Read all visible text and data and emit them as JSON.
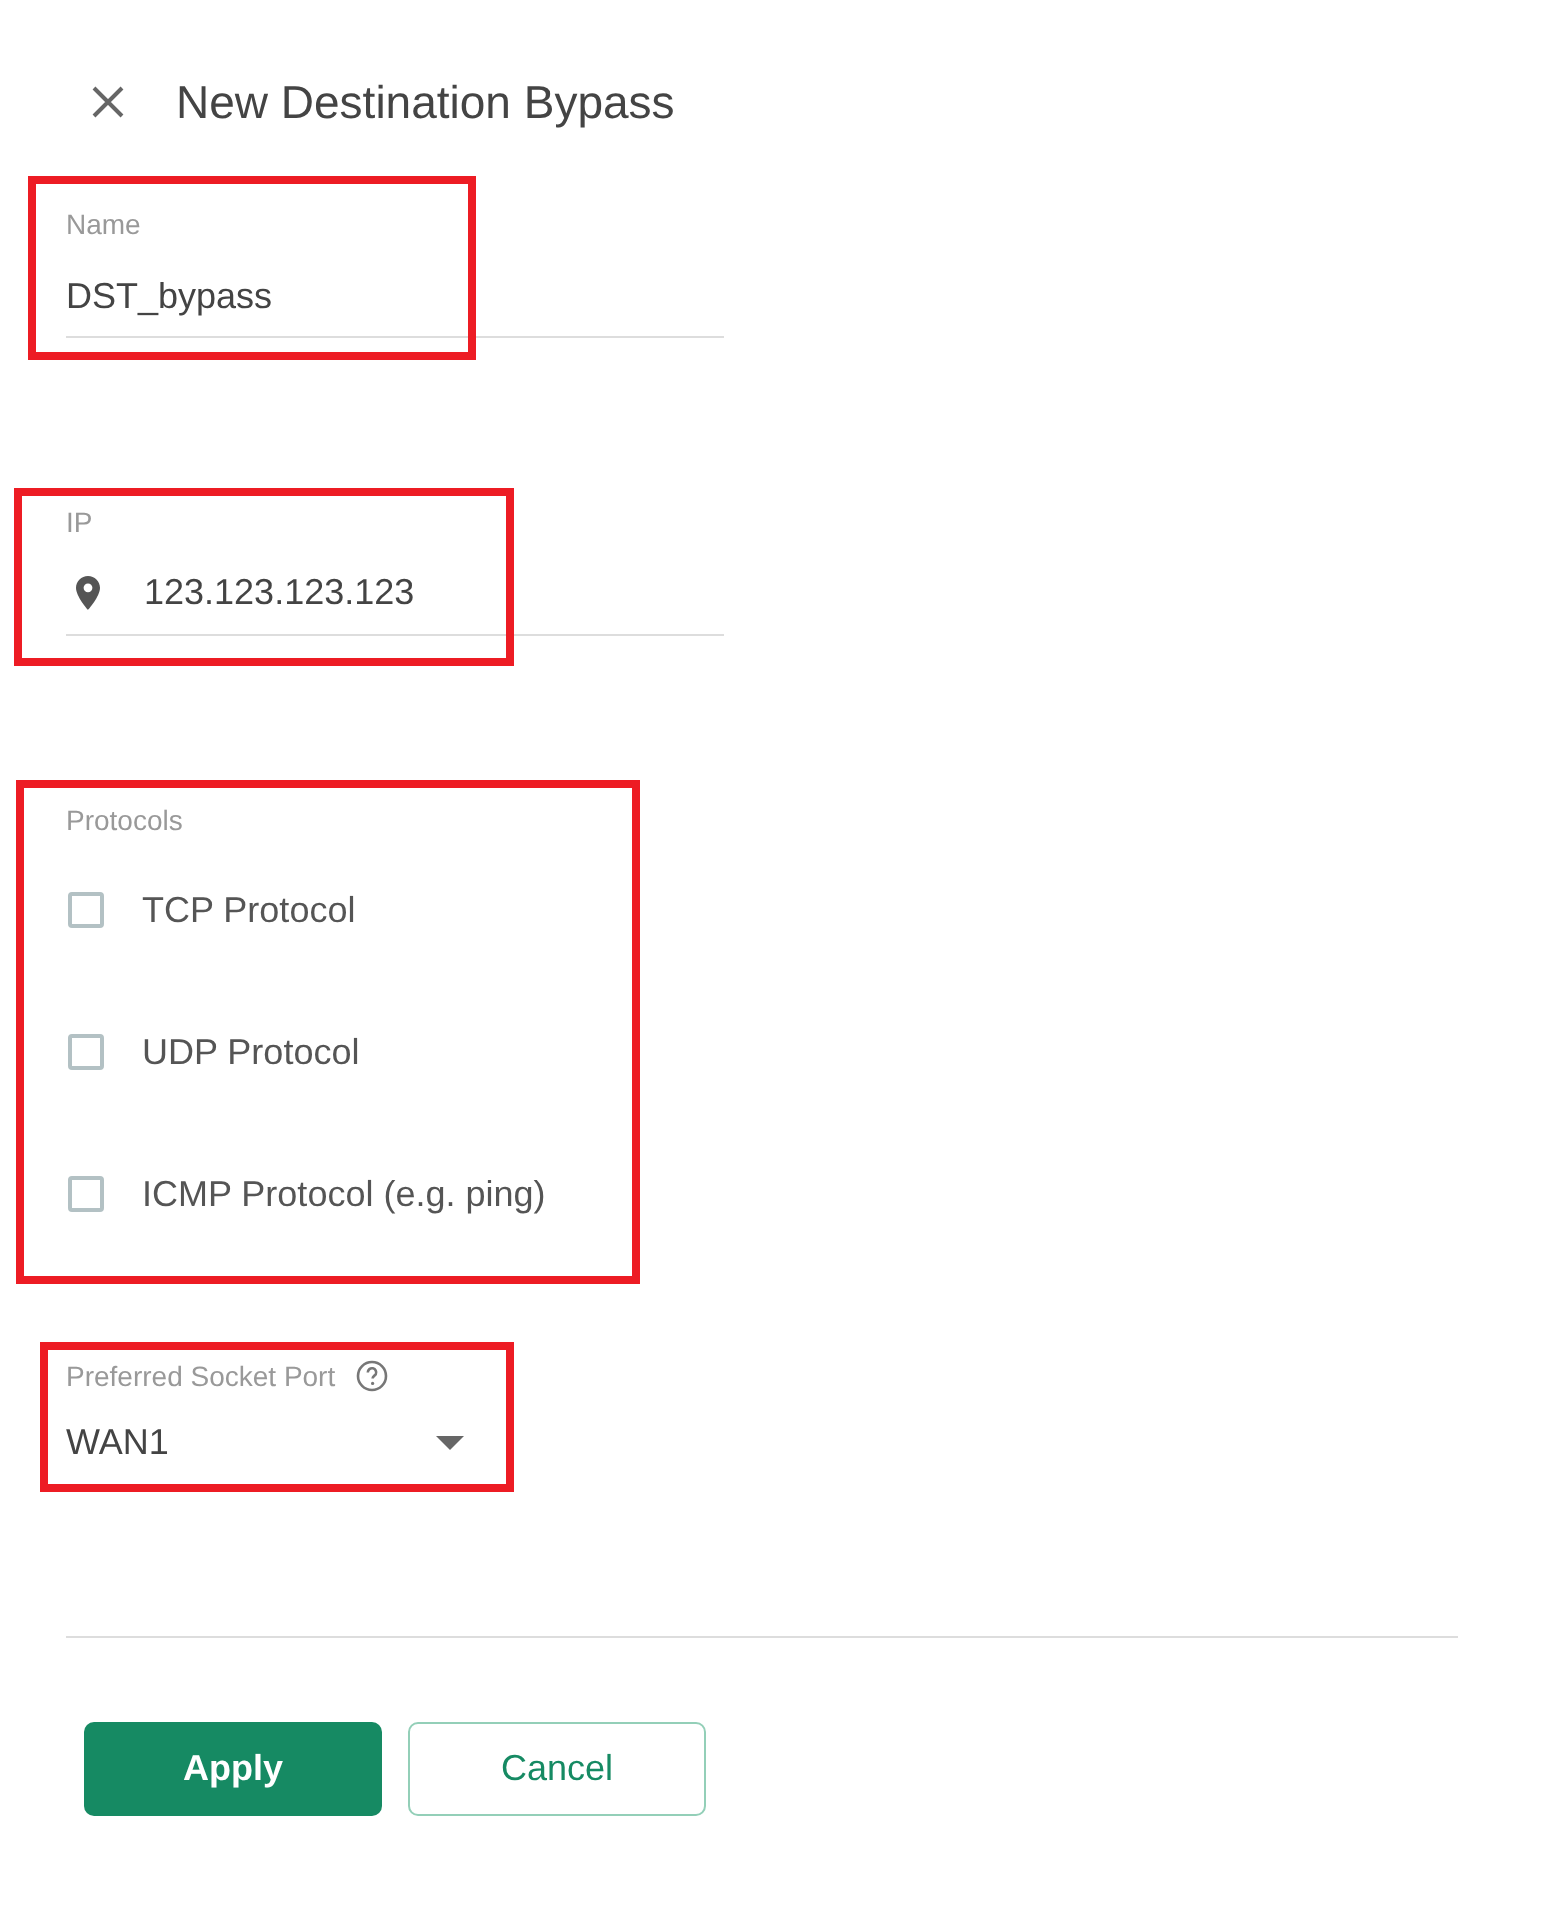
{
  "dialog": {
    "title": "New Destination Bypass"
  },
  "name_field": {
    "label": "Name",
    "value": "DST_bypass",
    "highlighted": true
  },
  "ip_field": {
    "label": "IP",
    "value": "123.123.123.123",
    "highlighted": true
  },
  "protocols": {
    "label": "Protocols",
    "highlighted": true,
    "options": [
      {
        "label": "TCP Protocol",
        "checked": false
      },
      {
        "label": "UDP Protocol",
        "checked": false
      },
      {
        "label": "ICMP Protocol (e.g. ping)",
        "checked": false
      }
    ]
  },
  "port_field": {
    "label": "Preferred Socket Port",
    "value": "WAN1",
    "highlighted": true
  },
  "buttons": [
    {
      "label": "Apply",
      "kind": "primary"
    },
    {
      "label": "Cancel",
      "kind": "secondary"
    }
  ]
}
